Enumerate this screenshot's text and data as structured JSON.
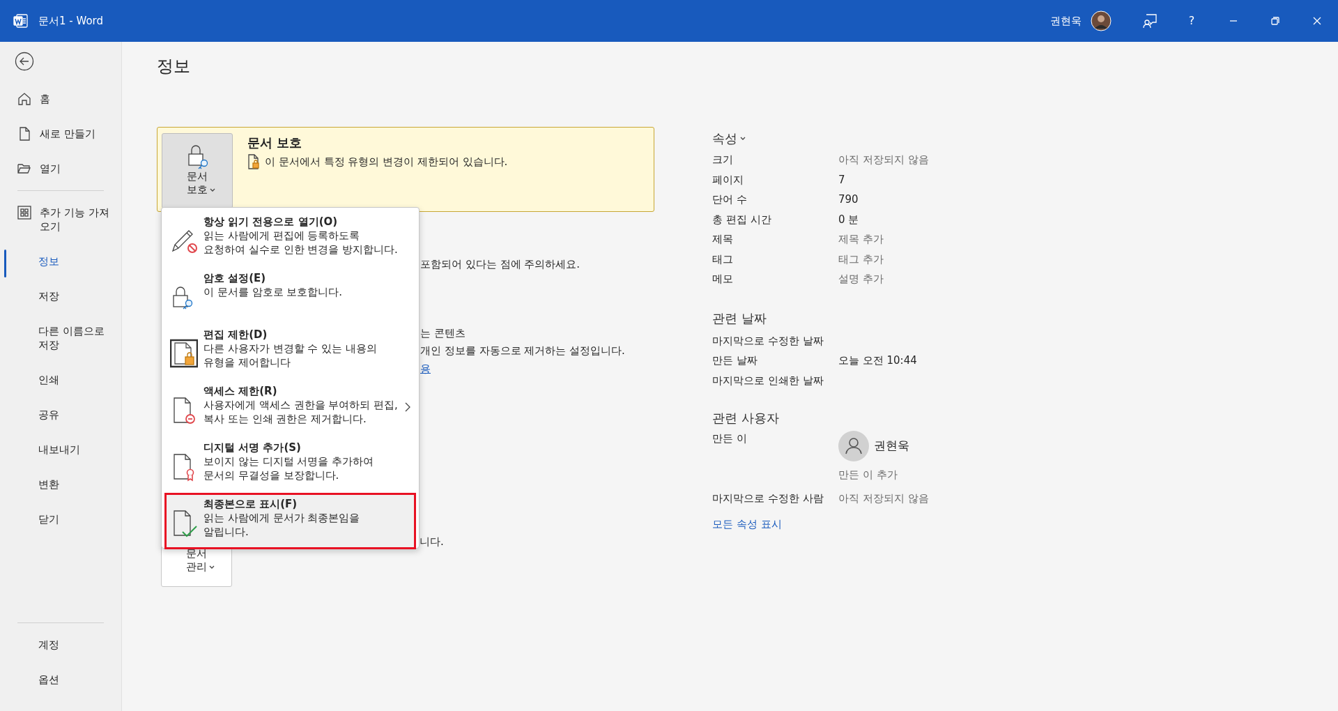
{
  "window": {
    "title": "문서1 - Word",
    "user_name": "권현욱",
    "help_label": "?"
  },
  "sidebar": {
    "items": [
      {
        "label": "홈",
        "kind": "home",
        "selected": false
      },
      {
        "label": "새로 만들기",
        "kind": "new",
        "selected": false
      },
      {
        "label": "열기",
        "kind": "open",
        "selected": false
      },
      {
        "label": "추가 기능 가져오기",
        "kind": "addins",
        "selected": false
      },
      {
        "label": "정보",
        "kind": "plain",
        "selected": true
      },
      {
        "label": "저장",
        "kind": "plain",
        "selected": false
      },
      {
        "label": "다른 이름으로 저장",
        "kind": "plain",
        "selected": false
      },
      {
        "label": "인쇄",
        "kind": "plain",
        "selected": false
      },
      {
        "label": "공유",
        "kind": "plain",
        "selected": false
      },
      {
        "label": "내보내기",
        "kind": "plain",
        "selected": false
      },
      {
        "label": "변환",
        "kind": "plain",
        "selected": false
      },
      {
        "label": "닫기",
        "kind": "plain",
        "selected": false
      }
    ],
    "bottom_items": [
      {
        "label": "계정",
        "selected": false
      },
      {
        "label": "옵션",
        "selected": false
      }
    ]
  },
  "heading": "정보",
  "protect_panel": {
    "button_label": "문서 보호",
    "title": "문서 보호",
    "message": "이 문서에서 특정 유형의 변경이 제한되어 있습니다."
  },
  "protect_menu": {
    "items": [
      {
        "kind": "readonly",
        "title": "항상 읽기 전용으로 열기(O)",
        "description_lines": [
          "읽는 사람에게 편집에 등록하도록",
          "요청하여 실수로 인한 변경을 방지합니다."
        ],
        "has_submenu": false,
        "highlighted": false
      },
      {
        "kind": "password",
        "title": "암호 설정(E)",
        "description_lines": [
          "이 문서를 암호로 보호합니다."
        ],
        "has_submenu": false,
        "highlighted": false
      },
      {
        "kind": "restrict_edit",
        "title": "편집 제한(D)",
        "description_lines": [
          "다른 사용자가 변경할 수 있는 내용의",
          "유형을 제어합니다"
        ],
        "has_submenu": false,
        "highlighted": false
      },
      {
        "kind": "restrict_access",
        "title": "액세스 제한(R)",
        "description_lines": [
          "사용자에게 액세스 권한을 부여하되 편집,",
          "복사 또는 인쇄 권한은 제거합니다."
        ],
        "has_submenu": true,
        "highlighted": false
      },
      {
        "kind": "signature",
        "title": "디지털 서명 추가(S)",
        "description_lines": [
          "보이지 않는 디지털 서명을 추가하여",
          "문서의 무결성을 보장합니다."
        ],
        "has_submenu": false,
        "highlighted": false
      },
      {
        "kind": "final",
        "title": "최종본으로 표시(F)",
        "description_lines": [
          "읽는 사람에게 문서가 최종본임을",
          "알립니다."
        ],
        "has_submenu": false,
        "highlighted": true
      }
    ]
  },
  "background_fragments": [
    {
      "kind": "text",
      "text": "포함되어 있다는 점에 주의하세요."
    },
    {
      "kind": "text",
      "text": "는 콘텐츠"
    },
    {
      "kind": "text",
      "text": "개인 정보를 자동으로 제거하는 설정입니다."
    },
    {
      "kind": "link",
      "text": "용"
    },
    {
      "kind": "text",
      "text": "니다."
    }
  ],
  "manage_button": {
    "label": "문서 관리"
  },
  "properties": {
    "heading": "속성",
    "rows": [
      {
        "label": "크기",
        "value": "아직 저장되지 않음",
        "muted": true
      },
      {
        "label": "페이지",
        "value": "7",
        "muted": false
      },
      {
        "label": "단어 수",
        "value": "790",
        "muted": false
      },
      {
        "label": "총 편집 시간",
        "value": "0 분",
        "muted": false
      },
      {
        "label": "제목",
        "value": "제목 추가",
        "muted": true
      },
      {
        "label": "태그",
        "value": "태그 추가",
        "muted": true
      },
      {
        "label": "메모",
        "value": "설명 추가",
        "muted": true
      }
    ]
  },
  "related_dates": {
    "heading": "관련 날짜",
    "rows": [
      {
        "label": "마지막으로 수정한 날짜"
      },
      {
        "label": "만든 날짜",
        "value": "오늘 오전 10:44"
      },
      {
        "label": "마지막으로 인쇄한 날짜"
      }
    ]
  },
  "related_people": {
    "heading": "관련 사용자",
    "author_label": "만든 이",
    "author_name": "권현욱",
    "add_author": "만든 이 추가",
    "modified_by_label": "마지막으로 수정한 사람",
    "modified_by_value": "아직 저장되지 않음"
  },
  "show_all_link": "모든 속성 표시"
}
